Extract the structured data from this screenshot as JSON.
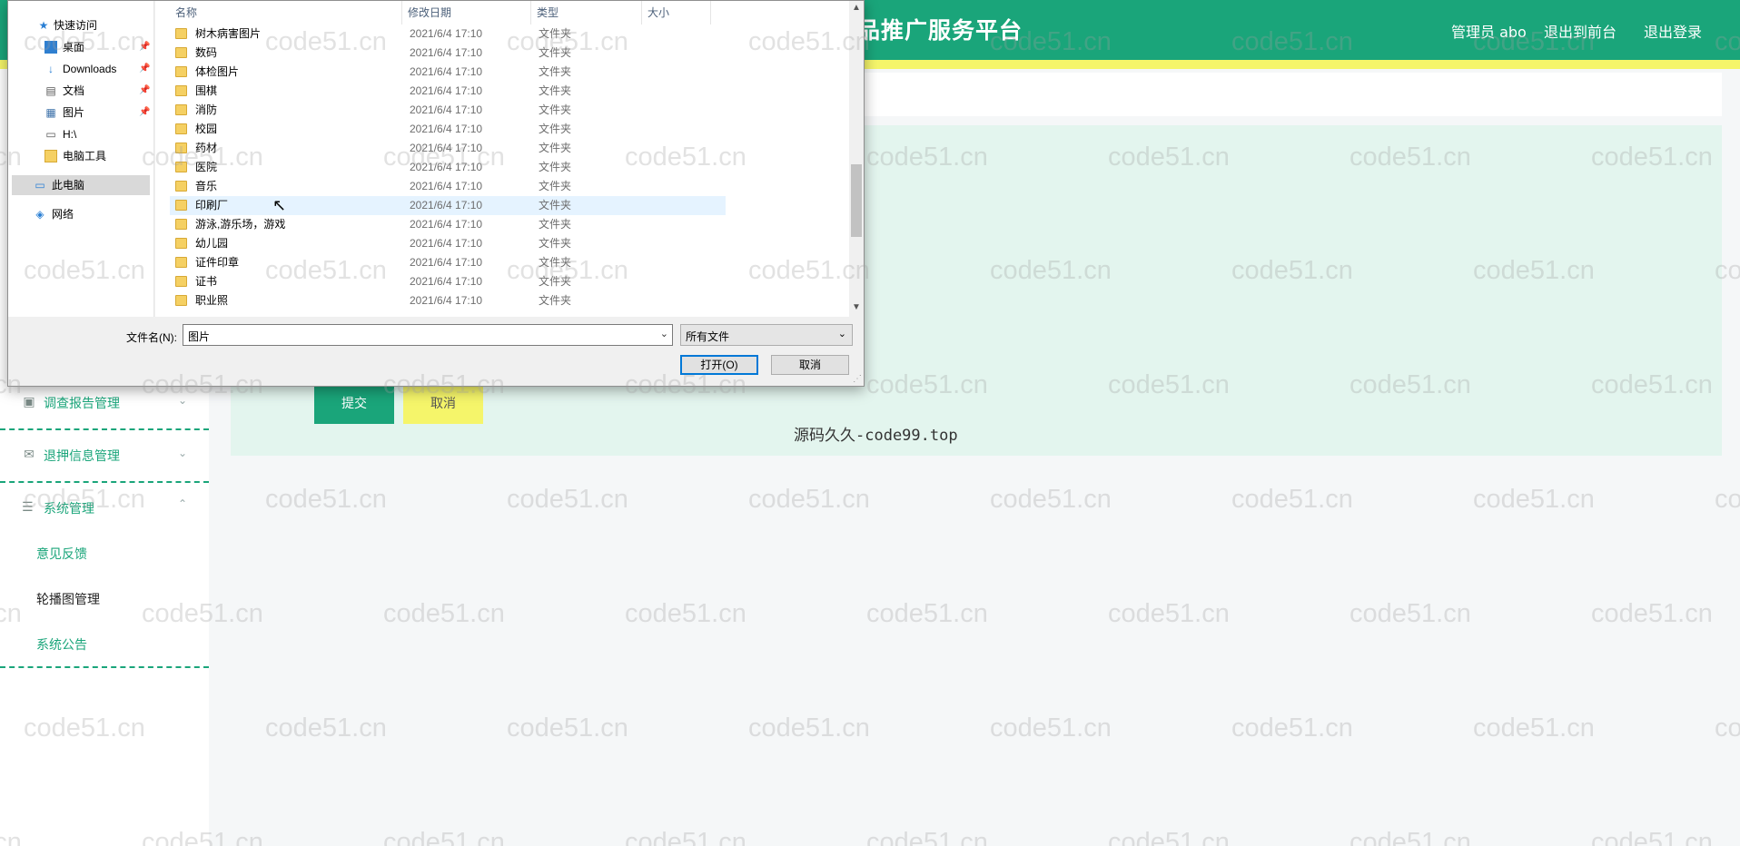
{
  "header": {
    "title": "品推广服务平台",
    "user_label": "管理员 abo",
    "back_to_front": "退出到前台",
    "logout": "退出登录"
  },
  "sidebar": {
    "menus": [
      {
        "label": "调查报告管理",
        "icon": "report-icon"
      },
      {
        "label": "退押信息管理",
        "icon": "mail-icon"
      },
      {
        "label": "系统管理",
        "icon": "settings-icon"
      }
    ],
    "sub_items": [
      "意见反馈",
      "轮播图管理",
      "系统公告"
    ]
  },
  "form": {
    "submit_label": "提交",
    "cancel_label": "取消"
  },
  "footer_text": "源码久久-code99.top",
  "watermark": "code51.cn",
  "colors": {
    "primary_green": "#1aa57a",
    "accent_yellow": "#f5f56a",
    "panel_bg": "#e3f5ee"
  },
  "dialog": {
    "nav": [
      {
        "label": "快速访问",
        "icon": "star-icon"
      },
      {
        "label": "桌面",
        "icon": "desktop-icon",
        "pinned": true
      },
      {
        "label": "Downloads",
        "icon": "download-icon",
        "pinned": true
      },
      {
        "label": "文档",
        "icon": "document-icon",
        "pinned": true
      },
      {
        "label": "图片",
        "icon": "picture-icon",
        "pinned": true
      },
      {
        "label": "H:\\",
        "icon": "drive-icon"
      },
      {
        "label": "电脑工具",
        "icon": "folder-icon"
      },
      {
        "label": "此电脑",
        "icon": "computer-icon",
        "selected": true
      },
      {
        "label": "网络",
        "icon": "network-icon"
      }
    ],
    "columns": [
      "名称",
      "修改日期",
      "类型",
      "大小"
    ],
    "files": [
      {
        "name": "树木病害图片",
        "date": "2021/6/4 17:10",
        "type": "文件夹"
      },
      {
        "name": "数码",
        "date": "2021/6/4 17:10",
        "type": "文件夹"
      },
      {
        "name": "体检图片",
        "date": "2021/6/4 17:10",
        "type": "文件夹"
      },
      {
        "name": "围棋",
        "date": "2021/6/4 17:10",
        "type": "文件夹"
      },
      {
        "name": "消防",
        "date": "2021/6/4 17:10",
        "type": "文件夹"
      },
      {
        "name": "校园",
        "date": "2021/6/4 17:10",
        "type": "文件夹"
      },
      {
        "name": "药材",
        "date": "2021/6/4 17:10",
        "type": "文件夹"
      },
      {
        "name": "医院",
        "date": "2021/6/4 17:10",
        "type": "文件夹"
      },
      {
        "name": "音乐",
        "date": "2021/6/4 17:10",
        "type": "文件夹"
      },
      {
        "name": "印刷厂",
        "date": "2021/6/4 17:10",
        "type": "文件夹",
        "hover": true
      },
      {
        "name": "游泳,游乐场，游戏",
        "date": "2021/6/4 17:10",
        "type": "文件夹"
      },
      {
        "name": "幼儿园",
        "date": "2021/6/4 17:10",
        "type": "文件夹"
      },
      {
        "name": "证件印章",
        "date": "2021/6/4 17:10",
        "type": "文件夹"
      },
      {
        "name": "证书",
        "date": "2021/6/4 17:10",
        "type": "文件夹"
      },
      {
        "name": "职业照",
        "date": "2021/6/4 17:10",
        "type": "文件夹"
      }
    ],
    "filename_label": "文件名(N):",
    "filename_value": "图片",
    "filter_value": "所有文件",
    "open_label": "打开(O)",
    "cancel_label": "取消"
  }
}
